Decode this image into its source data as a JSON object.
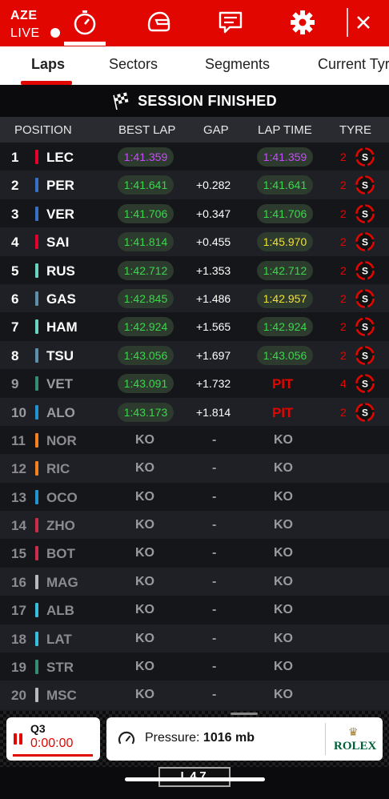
{
  "header": {
    "race_code": "AZE",
    "live_label": "LIVE",
    "icons": [
      "timer-icon",
      "helmet-icon",
      "chat-icon",
      "gear-icon",
      "close-icon"
    ],
    "accent": "#e10600"
  },
  "tabs": [
    {
      "label": "Laps",
      "active": true
    },
    {
      "label": "Sectors",
      "active": false
    },
    {
      "label": "Segments",
      "active": false
    },
    {
      "label": "Current Tyre",
      "active": false
    }
  ],
  "banner": {
    "text": "SESSION FINISHED"
  },
  "table": {
    "headers": {
      "position": "POSITION",
      "best_lap": "BEST LAP",
      "gap": "GAP",
      "lap_time": "LAP TIME",
      "tyre": "TYRE"
    },
    "rows": [
      {
        "pos": "1",
        "code": "LEC",
        "color": "#e8002d",
        "best": "1:41.359",
        "gap": "",
        "lap": "1:41.359",
        "best_color": "#c84bff",
        "lap_color": "#c84bff",
        "tyre_age": "2",
        "tyre": "S"
      },
      {
        "pos": "2",
        "code": "PER",
        "color": "#3671c6",
        "best": "1:41.641",
        "gap": "+0.282",
        "lap": "1:41.641",
        "best_color": "#39d84a",
        "lap_color": "#39d84a",
        "tyre_age": "2",
        "tyre": "S"
      },
      {
        "pos": "3",
        "code": "VER",
        "color": "#3671c6",
        "best": "1:41.706",
        "gap": "+0.347",
        "lap": "1:41.706",
        "best_color": "#39d84a",
        "lap_color": "#39d84a",
        "tyre_age": "2",
        "tyre": "S"
      },
      {
        "pos": "4",
        "code": "SAI",
        "color": "#e8002d",
        "best": "1:41.814",
        "gap": "+0.455",
        "lap": "1:45.970",
        "best_color": "#39d84a",
        "lap_color": "#f4e033",
        "tyre_age": "2",
        "tyre": "S"
      },
      {
        "pos": "5",
        "code": "RUS",
        "color": "#6cd3bf",
        "best": "1:42.712",
        "gap": "+1.353",
        "lap": "1:42.712",
        "best_color": "#39d84a",
        "lap_color": "#39d84a",
        "tyre_age": "2",
        "tyre": "S"
      },
      {
        "pos": "6",
        "code": "GAS",
        "color": "#5e8faa",
        "best": "1:42.845",
        "gap": "+1.486",
        "lap": "1:42.957",
        "best_color": "#39d84a",
        "lap_color": "#f4e033",
        "tyre_age": "2",
        "tyre": "S"
      },
      {
        "pos": "7",
        "code": "HAM",
        "color": "#6cd3bf",
        "best": "1:42.924",
        "gap": "+1.565",
        "lap": "1:42.924",
        "best_color": "#39d84a",
        "lap_color": "#39d84a",
        "tyre_age": "2",
        "tyre": "S"
      },
      {
        "pos": "8",
        "code": "TSU",
        "color": "#5e8faa",
        "best": "1:43.056",
        "gap": "+1.697",
        "lap": "1:43.056",
        "best_color": "#39d84a",
        "lap_color": "#39d84a",
        "tyre_age": "2",
        "tyre": "S"
      },
      {
        "pos": "9",
        "code": "VET",
        "color": "#358c75",
        "best": "1:43.091",
        "gap": "+1.732",
        "lap": "PIT",
        "best_color": "#39d84a",
        "lap_color": "#e10600",
        "tyre_age": "4",
        "tyre": "S",
        "dim": true
      },
      {
        "pos": "10",
        "code": "ALO",
        "color": "#2293d1",
        "best": "1:43.173",
        "gap": "+1.814",
        "lap": "PIT",
        "best_color": "#39d84a",
        "lap_color": "#e10600",
        "tyre_age": "2",
        "tyre": "S",
        "dim": true
      },
      {
        "pos": "11",
        "code": "NOR",
        "color": "#f58020",
        "best": "KO",
        "gap": "-",
        "lap": "KO",
        "out": true
      },
      {
        "pos": "12",
        "code": "RIC",
        "color": "#f58020",
        "best": "KO",
        "gap": "-",
        "lap": "KO",
        "out": true
      },
      {
        "pos": "13",
        "code": "OCO",
        "color": "#2293d1",
        "best": "KO",
        "gap": "-",
        "lap": "KO",
        "out": true
      },
      {
        "pos": "14",
        "code": "ZHO",
        "color": "#c92d4b",
        "best": "KO",
        "gap": "-",
        "lap": "KO",
        "out": true
      },
      {
        "pos": "15",
        "code": "BOT",
        "color": "#c92d4b",
        "best": "KO",
        "gap": "-",
        "lap": "KO",
        "out": true
      },
      {
        "pos": "16",
        "code": "MAG",
        "color": "#b6babd",
        "best": "KO",
        "gap": "-",
        "lap": "KO",
        "out": true
      },
      {
        "pos": "17",
        "code": "ALB",
        "color": "#37bedd",
        "best": "KO",
        "gap": "-",
        "lap": "KO",
        "out": true
      },
      {
        "pos": "18",
        "code": "LAT",
        "color": "#37bedd",
        "best": "KO",
        "gap": "-",
        "lap": "KO",
        "out": true
      },
      {
        "pos": "19",
        "code": "STR",
        "color": "#358c75",
        "best": "KO",
        "gap": "-",
        "lap": "KO",
        "out": true
      },
      {
        "pos": "20",
        "code": "MSC",
        "color": "#b6babd",
        "best": "KO",
        "gap": "-",
        "lap": "KO",
        "out": true
      }
    ]
  },
  "footer": {
    "session": "Q3",
    "time": "0:00:00",
    "pressure_label": "Pressure:",
    "pressure_value": "1016 mb",
    "sponsor": "ROLEX",
    "car_sign": "L47"
  }
}
